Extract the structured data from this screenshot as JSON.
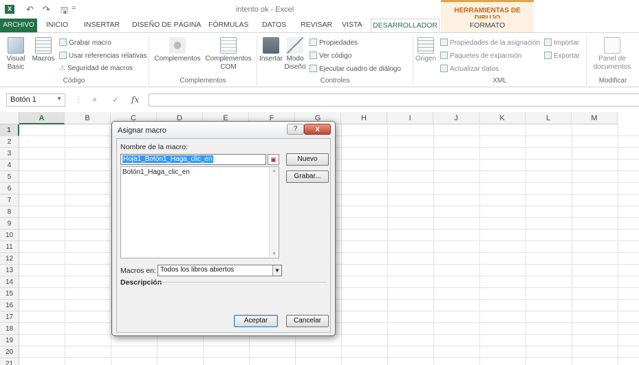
{
  "title": "intento ok - Excel",
  "qat": {
    "save": "🖫",
    "undo": "↶",
    "redo": "↷",
    "more": "="
  },
  "context_header": "HERRAMIENTAS DE DIBUJO",
  "tabs": {
    "archivo": "ARCHIVO",
    "items": [
      "INICIO",
      "INSERTAR",
      "DISEÑO DE PÁGINA",
      "FÓRMULAS",
      "DATOS",
      "REVISAR",
      "VISTA"
    ],
    "desarrollador": "DESARROLLADOR",
    "formato": "FORMATO"
  },
  "ribbon": {
    "codigo": {
      "label": "Código",
      "visual_basic": "Visual\nBasic",
      "macros": "Macros",
      "grabar": "Grabar macro",
      "referencias": "Usar referencias relativas",
      "seguridad": "Seguridad de macros"
    },
    "complementos": {
      "label": "Complementos",
      "complementos": "Complementos",
      "com": "Complementos\nCOM"
    },
    "controles": {
      "label": "Controles",
      "insertar": "Insertar",
      "modo_diseno": "Modo\nDiseño",
      "propiedades": "Propiedades",
      "ver_codigo": "Ver código",
      "ejecutar": "Ejecutar cuadro de diálogo"
    },
    "xml": {
      "label": "XML",
      "origen": "Origen",
      "propiedades_asig": "Propiedades de la asignación",
      "paquetes": "Paquetes de expansión",
      "actualizar": "Actualizar datos",
      "importar": "Importar",
      "exportar": "Exportar"
    },
    "modificar": {
      "label": "Modificar",
      "panel": "Panel de\ndocumentos"
    }
  },
  "formula_bar": {
    "name_box": "Botón 1",
    "cancel": "×",
    "enter": "✓",
    "fx": "fx",
    "value": ""
  },
  "grid": {
    "columns": [
      "A",
      "B",
      "C",
      "D",
      "E",
      "F",
      "G",
      "H",
      "I",
      "J",
      "K",
      "L",
      "M"
    ],
    "rows": [
      "1",
      "2",
      "3",
      "4",
      "5",
      "6",
      "7",
      "8",
      "9",
      "10",
      "11",
      "12",
      "13",
      "14",
      "15",
      "16",
      "17",
      "18",
      "19",
      "20",
      "21"
    ],
    "selected_column": "A",
    "selected_row": "1"
  },
  "dialog": {
    "title": "Asignar macro",
    "help": "?",
    "close": "x",
    "macro_name_label": "Nombre de la macro:",
    "macro_name_value": "Hoja1_Botón1_Haga_clic_en",
    "list_items": [
      "Botón1_Haga_clic_en"
    ],
    "nuevo": "Nuevo",
    "grabar": "Grabar...",
    "macros_en_label": "Macros en:",
    "macros_en_value": "Todos los libros abiertos",
    "descripcion_label": "Descripción",
    "aceptar": "Aceptar",
    "cancelar": "Cancelar"
  }
}
